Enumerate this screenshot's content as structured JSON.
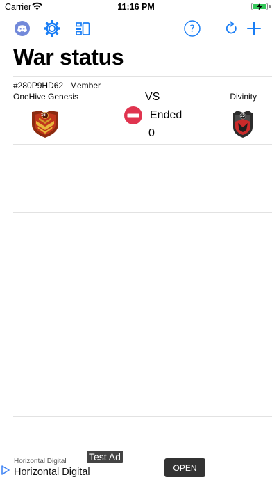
{
  "status_bar": {
    "carrier": "Carrier",
    "time": "11:16 PM",
    "battery_color": "#34c759"
  },
  "toolbar": {
    "icons": [
      "discord-icon",
      "settings-gear-icon",
      "list-layout-icon",
      "help-icon",
      "refresh-icon",
      "add-icon"
    ],
    "accent_color": "#1a7ef5"
  },
  "page": {
    "title": "War status"
  },
  "war": {
    "clan_tag": "#280P9HD62",
    "role": "Member",
    "clan_name": "OneHive Genesis",
    "vs_label": "VS",
    "state": "Ended",
    "score": "0",
    "opponent_name": "Divinity",
    "clan_badge_level": "16",
    "opponent_badge_level": "15"
  },
  "ad": {
    "advertiser_small": "Horizontal Digital",
    "advertiser_big": "Horizontal Digital",
    "cta": "OPEN",
    "test_label": "Test Ad"
  }
}
